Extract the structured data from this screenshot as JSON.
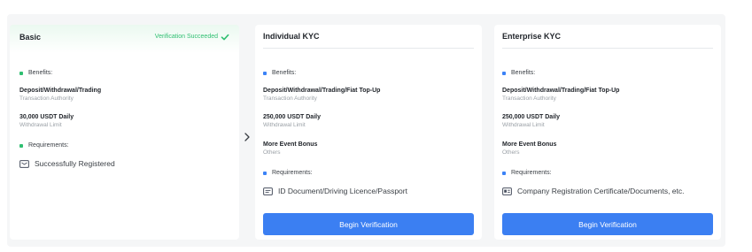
{
  "basic": {
    "title": "Basic",
    "status": "Verification Succeeded",
    "benefits_label": "Benefits:",
    "benefits": [
      {
        "title": "Deposit/Withdrawal/Trading",
        "sub": "Transaction Authority"
      },
      {
        "title": "30,000 USDT Daily",
        "sub": "Withdrawal Limit"
      }
    ],
    "requirements_label": "Requirements:",
    "requirement": "Successfully Registered"
  },
  "individual": {
    "title": "Individual KYC",
    "benefits_label": "Benefits:",
    "benefits": [
      {
        "title": "Deposit/Withdrawal/Trading/Fiat Top-Up",
        "sub": "Transaction Authority"
      },
      {
        "title": "250,000 USDT Daily",
        "sub": "Withdrawal Limit"
      },
      {
        "title": "More Event Bonus",
        "sub": "Others"
      }
    ],
    "requirements_label": "Requirements:",
    "requirement": "ID Document/Driving Licence/Passport",
    "button": "Begin Verification"
  },
  "enterprise": {
    "title": "Enterprise KYC",
    "benefits_label": "Benefits:",
    "benefits": [
      {
        "title": "Deposit/Withdrawal/Trading/Fiat Top-Up",
        "sub": "Transaction Authority"
      },
      {
        "title": "250,000 USDT Daily",
        "sub": "Withdrawal Limit"
      },
      {
        "title": "More Event Bonus",
        "sub": "Others"
      }
    ],
    "requirements_label": "Requirements:",
    "requirement": "Company Registration Certificate/Documents, etc.",
    "button": "Begin Verification"
  },
  "colors": {
    "success": "#2fbf71",
    "accent": "#3b7ff2",
    "card_bg": "#ffffff",
    "panel_bg": "#f5f6f7"
  },
  "icons": {
    "status": "check-icon",
    "next": "chevron-right-icon",
    "basic_requirement": "mail-icon",
    "individual_requirement": "id-card-icon",
    "enterprise_requirement": "business-card-icon"
  }
}
